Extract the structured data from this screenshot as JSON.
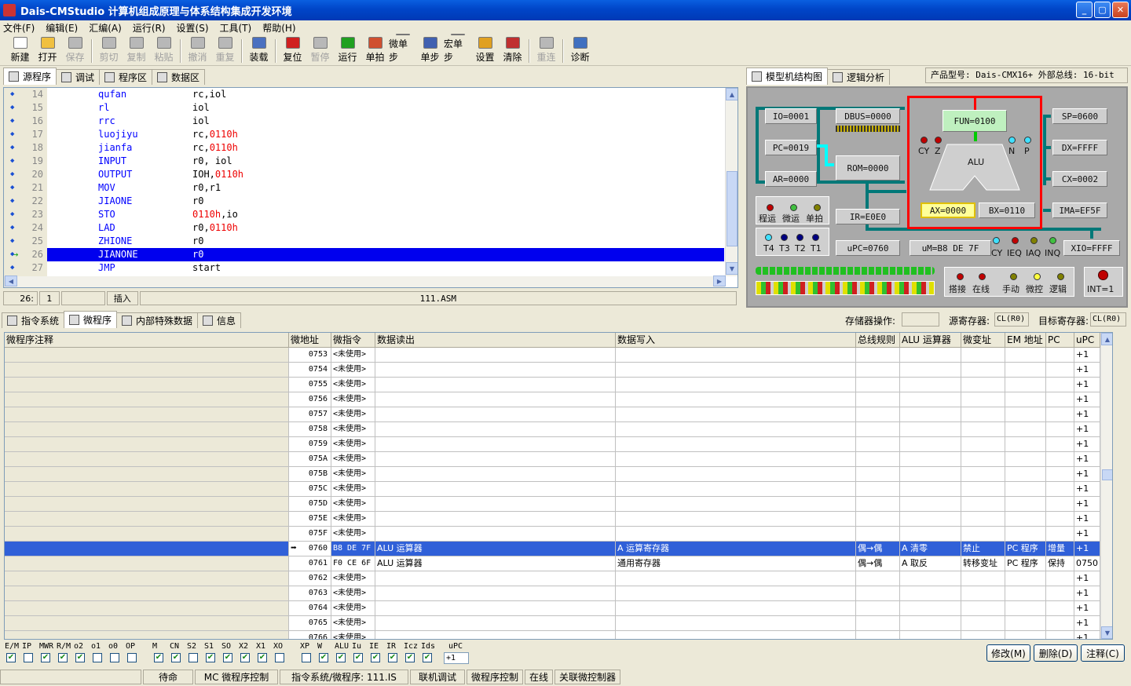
{
  "window": {
    "title": "Dais-CMStudio 计算机组成原理与体系结构集成开发环境",
    "btn_min": "_",
    "btn_max": "▢",
    "btn_close": "✕"
  },
  "menu": [
    "文件(F)",
    "编辑(E)",
    "汇编(A)",
    "运行(R)",
    "设置(S)",
    "工具(T)",
    "帮助(H)"
  ],
  "toolbar": [
    {
      "label": "新建",
      "icon": "new-file-icon",
      "enabled": true,
      "color": "#ffffff"
    },
    {
      "label": "打开",
      "icon": "open-folder-icon",
      "enabled": true,
      "color": "#f0c040"
    },
    {
      "label": "保存",
      "icon": "save-icon",
      "enabled": false,
      "color": "#b8b8b8"
    },
    {
      "sep": true
    },
    {
      "label": "剪切",
      "icon": "cut-icon",
      "enabled": false,
      "color": "#b8b8b8"
    },
    {
      "label": "复制",
      "icon": "copy-icon",
      "enabled": false,
      "color": "#b8b8b8"
    },
    {
      "label": "粘贴",
      "icon": "paste-icon",
      "enabled": false,
      "color": "#b8b8b8"
    },
    {
      "sep": true
    },
    {
      "label": "撤消",
      "icon": "undo-icon",
      "enabled": false,
      "color": "#b8b8b8"
    },
    {
      "label": "重复",
      "icon": "redo-icon",
      "enabled": false,
      "color": "#b8b8b8"
    },
    {
      "sep": true
    },
    {
      "label": "装载",
      "icon": "load-icon",
      "enabled": true,
      "color": "#4a70c0"
    },
    {
      "sep": true
    },
    {
      "label": "复位",
      "icon": "reset-icon",
      "enabled": true,
      "color": "#d02020"
    },
    {
      "label": "暂停",
      "icon": "pause-icon",
      "enabled": false,
      "color": "#b8b8b8"
    },
    {
      "label": "运行",
      "icon": "run-icon",
      "enabled": true,
      "color": "#20a020"
    },
    {
      "label": "单拍",
      "icon": "single-beat-icon",
      "enabled": true,
      "color": "#d05030"
    },
    {
      "label": "微单步",
      "icon": "micro-step-icon",
      "enabled": true,
      "color": "#c04040"
    },
    {
      "label": "单步",
      "icon": "single-step-icon",
      "enabled": true,
      "color": "#4060b0"
    },
    {
      "label": "宏单步",
      "icon": "macro-step-icon",
      "enabled": true,
      "color": "#4060b0"
    },
    {
      "label": "设置",
      "icon": "breakpoint-set-icon",
      "enabled": true,
      "color": "#e0a020"
    },
    {
      "label": "清除",
      "icon": "breakpoint-clear-icon",
      "enabled": true,
      "color": "#c03030"
    },
    {
      "sep": true
    },
    {
      "label": "重连",
      "icon": "reconnect-icon",
      "enabled": false,
      "color": "#b8b8b8"
    },
    {
      "sep": true
    },
    {
      "label": "诊断",
      "icon": "diagnose-icon",
      "enabled": true,
      "color": "#4070c0"
    }
  ],
  "left_tabs": [
    {
      "label": "源程序",
      "active": true
    },
    {
      "label": "调试",
      "active": false
    },
    {
      "label": "程序区",
      "active": false
    },
    {
      "label": "数据区",
      "active": false
    }
  ],
  "right_tabs": [
    {
      "label": "模型机结构图",
      "active": true
    },
    {
      "label": "逻辑分析",
      "active": false
    }
  ],
  "product_info": "产品型号: Dais-CMX16+  外部总线: 16-bit",
  "code_lines": [
    {
      "n": "14",
      "op": "qufan",
      "args": [
        {
          "t": "rc,iol",
          "h": false
        }
      ]
    },
    {
      "n": "15",
      "op": "rl",
      "args": [
        {
          "t": "iol",
          "h": false
        }
      ]
    },
    {
      "n": "16",
      "op": "rrc",
      "args": [
        {
          "t": "iol",
          "h": false
        }
      ]
    },
    {
      "n": "17",
      "op": "luojiyu",
      "args": [
        {
          "t": "rc,",
          "h": false
        },
        {
          "t": "0110h",
          "h": true
        }
      ]
    },
    {
      "n": "18",
      "op": "jianfa",
      "args": [
        {
          "t": "rc,",
          "h": false
        },
        {
          "t": "0110h",
          "h": true
        }
      ]
    },
    {
      "n": "19",
      "op": "INPUT",
      "args": [
        {
          "t": "r0, iol",
          "h": false
        }
      ]
    },
    {
      "n": "20",
      "op": "OUTPUT",
      "args": [
        {
          "t": "IOH,",
          "h": false
        },
        {
          "t": "0110h",
          "h": true
        }
      ]
    },
    {
      "n": "21",
      "op": "MOV",
      "args": [
        {
          "t": "r0,r1",
          "h": false
        }
      ]
    },
    {
      "n": "22",
      "op": "JIAONE",
      "args": [
        {
          "t": "r0",
          "h": false
        }
      ]
    },
    {
      "n": "23",
      "op": "STO",
      "args": [
        {
          "t": "0110h",
          "h": true
        },
        {
          "t": ",io",
          "h": false
        }
      ]
    },
    {
      "n": "24",
      "op": "LAD",
      "args": [
        {
          "t": "r0,",
          "h": false
        },
        {
          "t": "0110h",
          "h": true
        }
      ]
    },
    {
      "n": "25",
      "op": "ZHIONE",
      "args": [
        {
          "t": "r0",
          "h": false
        }
      ]
    },
    {
      "n": "26",
      "op": "JIANONE",
      "args": [
        {
          "t": "r0",
          "h": false
        }
      ],
      "current": true
    },
    {
      "n": "27",
      "op": "JMP",
      "args": [
        {
          "t": "start",
          "h": false
        }
      ]
    }
  ],
  "editor_status": {
    "line": "26:",
    "col": "1",
    "mode": "插入",
    "file": "111.ASM"
  },
  "model": {
    "io": "IO=0001",
    "dbus": "DBUS=0000",
    "pc": "PC=0019",
    "rom": "ROM=0000",
    "ar": "AR=0000",
    "ir": "IR=E0E0",
    "upc": "uPC=0760",
    "fun": "FUN=0100",
    "alu": "ALU",
    "ax": "AX=0000",
    "bx": "BX=0110",
    "um": "uM=B8  DE  7F",
    "sp": "SP=0600",
    "dx": "DX=FFFF",
    "cx": "CX=0002",
    "ima": "IMA=EF5F",
    "xio": "XIO=FFFF",
    "flags_top": [
      "CY",
      "Z",
      "N",
      "P"
    ],
    "run_labels": [
      "程运",
      "微运",
      "单拍"
    ],
    "t_labels": [
      "T4",
      "T3",
      "T2",
      "T1"
    ],
    "int_flags": [
      "CY",
      "IEQ",
      "IAQ",
      "INQ"
    ],
    "mode_labels": [
      "搭接",
      "在线",
      "手动",
      "微控",
      "逻辑"
    ],
    "int": "INT=1"
  },
  "bottom_tabs": [
    {
      "label": "指令系统",
      "active": false
    },
    {
      "label": "微程序",
      "active": true
    },
    {
      "label": "内部特殊数据",
      "active": false
    },
    {
      "label": "信息",
      "active": false
    }
  ],
  "storage": {
    "op_label": "存储器操作:",
    "op_value": "",
    "src_label": "源寄存器:",
    "src_value": "CL(R0)",
    "dst_label": "目标寄存器:",
    "dst_value": "CL(R0)"
  },
  "table_headers": [
    "微程序注释",
    "微地址",
    "微指令",
    "数据读出",
    "数据写入",
    "总线规则",
    "ALU 运算器",
    "微变址",
    "EM 地址",
    "PC",
    "uPC"
  ],
  "table_rows": [
    {
      "addr": "0753",
      "instr": "<未使用>",
      "upc": "+1"
    },
    {
      "addr": "0754",
      "instr": "<未使用>",
      "upc": "+1"
    },
    {
      "addr": "0755",
      "instr": "<未使用>",
      "upc": "+1"
    },
    {
      "addr": "0756",
      "instr": "<未使用>",
      "upc": "+1"
    },
    {
      "addr": "0757",
      "instr": "<未使用>",
      "upc": "+1"
    },
    {
      "addr": "0758",
      "instr": "<未使用>",
      "upc": "+1"
    },
    {
      "addr": "0759",
      "instr": "<未使用>",
      "upc": "+1"
    },
    {
      "addr": "075A",
      "instr": "<未使用>",
      "upc": "+1"
    },
    {
      "addr": "075B",
      "instr": "<未使用>",
      "upc": "+1"
    },
    {
      "addr": "075C",
      "instr": "<未使用>",
      "upc": "+1"
    },
    {
      "addr": "075D",
      "instr": "<未使用>",
      "upc": "+1"
    },
    {
      "addr": "075E",
      "instr": "<未使用>",
      "upc": "+1"
    },
    {
      "addr": "075F",
      "instr": "<未使用>",
      "upc": "+1"
    },
    {
      "addr": "0760",
      "instr": "B8 DE 7F",
      "read": "ALU 运算器",
      "write": "A 运算寄存器",
      "bus": "偶→偶",
      "alu": "A 清零",
      "vi": "禁止",
      "em": "PC 程序",
      "pc": "增量",
      "upc": "+1",
      "current": true
    },
    {
      "addr": "0761",
      "instr": "F0 CE 6F",
      "read": "ALU 运算器",
      "write": "通用寄存器",
      "bus": "偶→偶",
      "alu": "A 取反",
      "vi": "转移变址",
      "em": "PC 程序",
      "pc": "保持",
      "upc": "0750"
    },
    {
      "addr": "0762",
      "instr": "<未使用>",
      "upc": "+1"
    },
    {
      "addr": "0763",
      "instr": "<未使用>",
      "upc": "+1"
    },
    {
      "addr": "0764",
      "instr": "<未使用>",
      "upc": "+1"
    },
    {
      "addr": "0765",
      "instr": "<未使用>",
      "upc": "+1"
    },
    {
      "addr": "0766",
      "instr": "<未使用>",
      "upc": "+1"
    }
  ],
  "ctrl_bits": [
    {
      "l": "E/M",
      "c": true
    },
    {
      "l": "IP",
      "c": false
    },
    {
      "l": "MWR",
      "c": true
    },
    {
      "l": "R/M",
      "c": true
    },
    {
      "l": "o2",
      "c": true
    },
    {
      "l": "o1",
      "c": false
    },
    {
      "l": "o0",
      "c": false
    },
    {
      "l": "OP",
      "c": false
    },
    {
      "l": "M",
      "c": true
    },
    {
      "l": "CN",
      "c": true
    },
    {
      "l": "S2",
      "c": false
    },
    {
      "l": "S1",
      "c": true
    },
    {
      "l": "SO",
      "c": true
    },
    {
      "l": "X2",
      "c": true
    },
    {
      "l": "X1",
      "c": true
    },
    {
      "l": "XO",
      "c": false
    },
    {
      "l": "XP",
      "c": false
    },
    {
      "l": "W",
      "c": true
    },
    {
      "l": "ALU",
      "c": true
    },
    {
      "l": "Iu",
      "c": true
    },
    {
      "l": "IE",
      "c": true
    },
    {
      "l": "IR",
      "c": true
    },
    {
      "l": "Icz",
      "c": true
    },
    {
      "l": "Ids",
      "c": true
    }
  ],
  "upc_label": "uPC",
  "upc_value": "+1",
  "buttons": {
    "modify": "修改(M)",
    "delete": "删除(D)",
    "comment": "注释(C)"
  },
  "statusbar": [
    "",
    "待命",
    "MC 微程序控制",
    "指令系统/微程序: 111.IS",
    "联机调试",
    "微程序控制",
    "在线",
    "关联微控制器"
  ],
  "colors": {
    "title": "#0045c8",
    "selection": "#0000ee",
    "table_sel": "#3060d8",
    "bus": "#007878",
    "alu_box": "#ff0000",
    "fun_box": "#bff0bf",
    "ax_box": "#ffff99"
  }
}
